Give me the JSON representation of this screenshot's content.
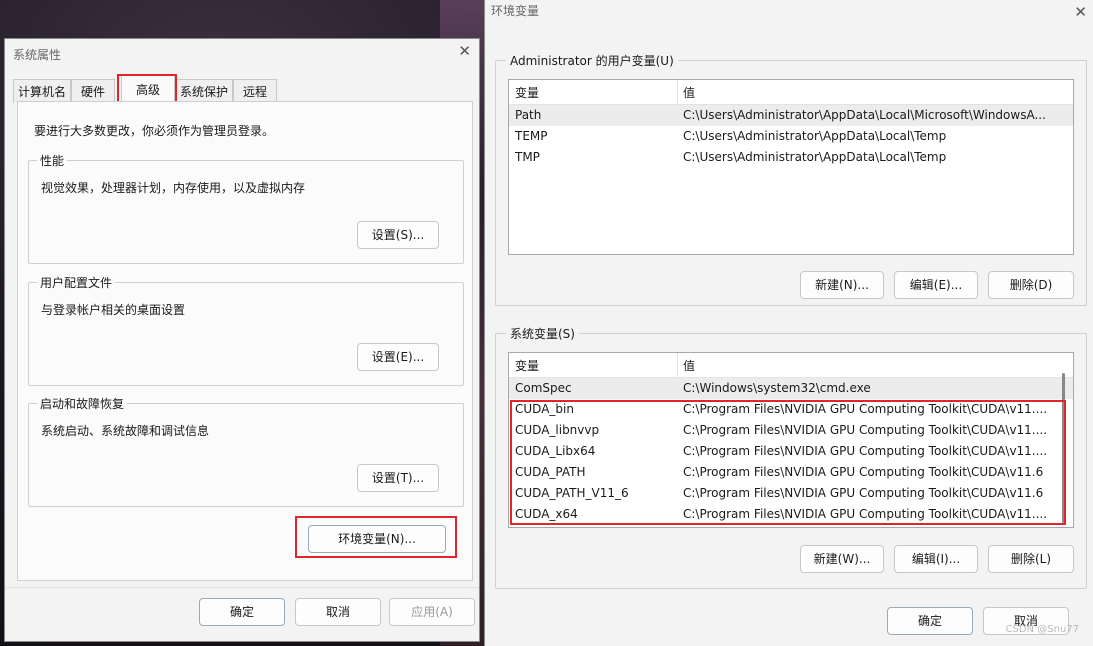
{
  "left_dialog": {
    "title": "系统属性",
    "tabs": [
      "计算机名",
      "硬件",
      "高级",
      "系统保护",
      "远程"
    ],
    "notice": "要进行大多数更改，你必须作为管理员登录。",
    "performance": {
      "title": "性能",
      "desc": "视觉效果，处理器计划，内存使用，以及虚拟内存",
      "button": "设置(S)..."
    },
    "user_profiles": {
      "title": "用户配置文件",
      "desc": "与登录帐户相关的桌面设置",
      "button": "设置(E)..."
    },
    "startup": {
      "title": "启动和故障恢复",
      "desc": "系统启动、系统故障和调试信息",
      "button": "设置(T)..."
    },
    "env_button": "环境变量(N)...",
    "ok": "确定",
    "cancel": "取消",
    "apply": "应用(A)"
  },
  "right_dialog": {
    "title": "环境变量",
    "user_vars": {
      "title": "Administrator 的用户变量(U)",
      "col_var": "变量",
      "col_val": "值",
      "rows": [
        {
          "name": "Path",
          "value": "C:\\Users\\Administrator\\AppData\\Local\\Microsoft\\WindowsA..."
        },
        {
          "name": "TEMP",
          "value": "C:\\Users\\Administrator\\AppData\\Local\\Temp"
        },
        {
          "name": "TMP",
          "value": "C:\\Users\\Administrator\\AppData\\Local\\Temp"
        }
      ],
      "new": "新建(N)...",
      "edit": "编辑(E)...",
      "delete": "删除(D)"
    },
    "system_vars": {
      "title": "系统变量(S)",
      "col_var": "变量",
      "col_val": "值",
      "rows": [
        {
          "name": "ComSpec",
          "value": "C:\\Windows\\system32\\cmd.exe"
        },
        {
          "name": "CUDA_bin",
          "value": "C:\\Program Files\\NVIDIA GPU Computing Toolkit\\CUDA\\v11...."
        },
        {
          "name": "CUDA_libnvvp",
          "value": "C:\\Program Files\\NVIDIA GPU Computing Toolkit\\CUDA\\v11...."
        },
        {
          "name": "CUDA_Libx64",
          "value": "C:\\Program Files\\NVIDIA GPU Computing Toolkit\\CUDA\\v11...."
        },
        {
          "name": "CUDA_PATH",
          "value": "C:\\Program Files\\NVIDIA GPU Computing Toolkit\\CUDA\\v11.6"
        },
        {
          "name": "CUDA_PATH_V11_6",
          "value": "C:\\Program Files\\NVIDIA GPU Computing Toolkit\\CUDA\\v11.6"
        },
        {
          "name": "CUDA_x64",
          "value": "C:\\Program Files\\NVIDIA GPU Computing Toolkit\\CUDA\\v11...."
        }
      ],
      "new": "新建(W)...",
      "edit": "编辑(I)...",
      "delete": "删除(L)"
    },
    "ok": "确定",
    "cancel": "取消"
  },
  "watermark": "CSDN @Snu77",
  "colors": {
    "highlight": "#e0262c",
    "dialog_bg": "#f3f3f3"
  }
}
